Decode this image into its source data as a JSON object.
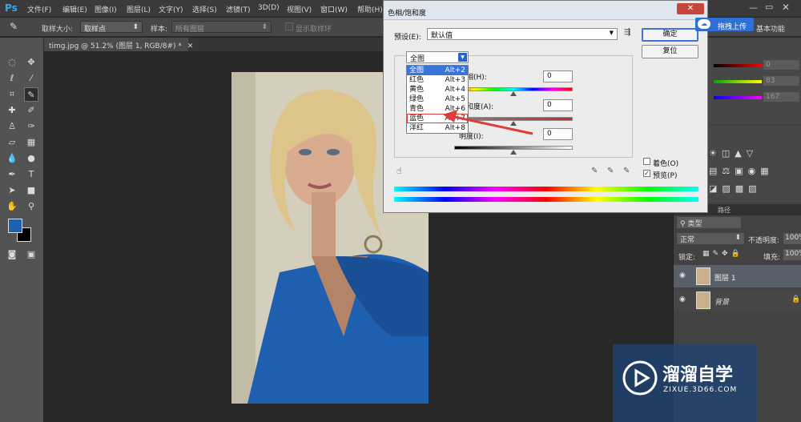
{
  "app": {
    "logo": "Ps",
    "menu": [
      "文件(F)",
      "编辑(E)",
      "图像(I)",
      "图层(L)",
      "文字(Y)",
      "选择(S)",
      "滤镜(T)",
      "3D(D)",
      "视图(V)",
      "窗口(W)",
      "帮助(H)"
    ],
    "workspace": "基本功能"
  },
  "options": {
    "sample_size_label": "取样大小:",
    "sample_size_value": "取样点",
    "sample_label": "样本:",
    "sample_value": "所有图层",
    "show_ring": "显示取样环"
  },
  "document": {
    "tab": "timg.jpg @ 51.2% (图层 1, RGB/8#) *"
  },
  "dialog": {
    "title": "色相/饱和度",
    "preset_label": "预设(E):",
    "preset_value": "默认值",
    "ok": "确定",
    "reset": "复位",
    "channel_value": "全图",
    "hue_label": "色相(H):",
    "hue_value": "0",
    "saturation_label": "饱和度(A):",
    "saturation_value": "0",
    "lightness_label": "明度(I):",
    "lightness_value": "0",
    "colorize": "着色(O)",
    "preview": "预览(P)",
    "channels": [
      {
        "name": "全图",
        "shortcut": "Alt+2"
      },
      {
        "name": "红色",
        "shortcut": "Alt+3"
      },
      {
        "name": "黄色",
        "shortcut": "Alt+4"
      },
      {
        "name": "绿色",
        "shortcut": "Alt+5"
      },
      {
        "name": "青色",
        "shortcut": "Alt+6"
      },
      {
        "name": "蓝色",
        "shortcut": "Alt+7"
      },
      {
        "name": "洋红",
        "shortcut": "Alt+8"
      }
    ]
  },
  "panels": {
    "color_values": [
      "0",
      "83",
      "167"
    ],
    "layers_tab": "路径",
    "kind_label": "类型",
    "blend_mode": "正常",
    "opacity_label": "不透明度:",
    "opacity_value": "100%",
    "lock_label": "锁定:",
    "fill_label": "填充:",
    "fill_value": "100%",
    "layers": [
      {
        "name": "图层 1"
      },
      {
        "name": "背景"
      }
    ]
  },
  "overlay": {
    "upload_button": "拖拽上传",
    "watermark_title": "溜溜自学",
    "watermark_url": "ZIXUE.3D66.COM"
  },
  "colors": {
    "foreground": "#1f5fb0",
    "background": "#000000",
    "accent": "#3b74d8"
  }
}
